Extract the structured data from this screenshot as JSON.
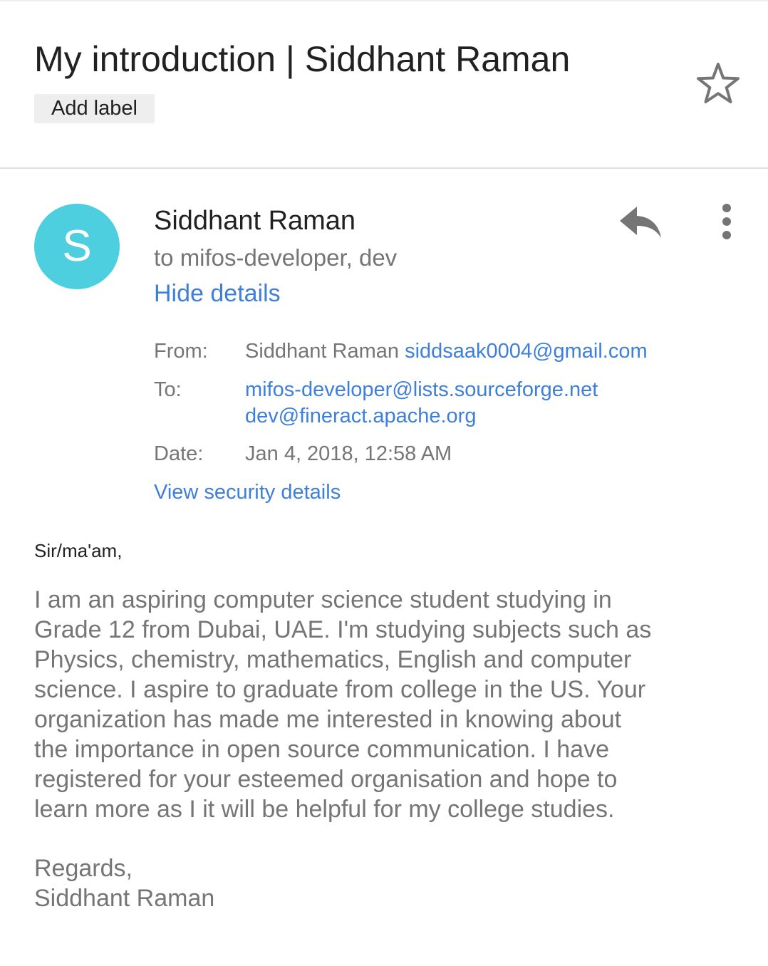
{
  "email": {
    "subject": "My introduction | Siddhant Raman",
    "add_label": "Add label",
    "star_icon": "star-outline-icon",
    "sender": {
      "name": "Siddhant Raman",
      "avatar_letter": "S",
      "avatar_color": "#4ecfe0",
      "recipients_summary": "to mifos-developer, dev",
      "hide_details": "Hide details"
    },
    "actions": {
      "reply_icon": "reply-icon",
      "more_icon": "more-vertical-icon"
    },
    "details": {
      "from_label": "From:",
      "from_name": "Siddhant Raman",
      "from_email": "siddsaak0004@gmail.com",
      "to_label": "To:",
      "to_emails": [
        "mifos-developer@lists.sourceforge.net",
        "dev@fineract.apache.org"
      ],
      "date_label": "Date:",
      "date_value": "Jan 4, 2018, 12:58 AM",
      "view_security": "View security details"
    },
    "body": {
      "greeting": "Sir/ma'am,",
      "lines": [
        "I am an aspiring computer science student studying in",
        "Grade 12 from Dubai, UAE. I'm studying subjects such as",
        "Physics, chemistry, mathematics, English and computer",
        "science. I aspire to graduate from college in the US. Your",
        "organization has made me interested in knowing about",
        "the importance in open source communication. I have",
        "registered for your esteemed organisation and hope to",
        "learn more as I it will be helpful for my college studies."
      ],
      "closing": "Regards,",
      "signature": "Siddhant Raman"
    },
    "colors": {
      "link": "#3d7fd9",
      "secondary_text": "#757575",
      "primary_text": "#212121"
    }
  }
}
